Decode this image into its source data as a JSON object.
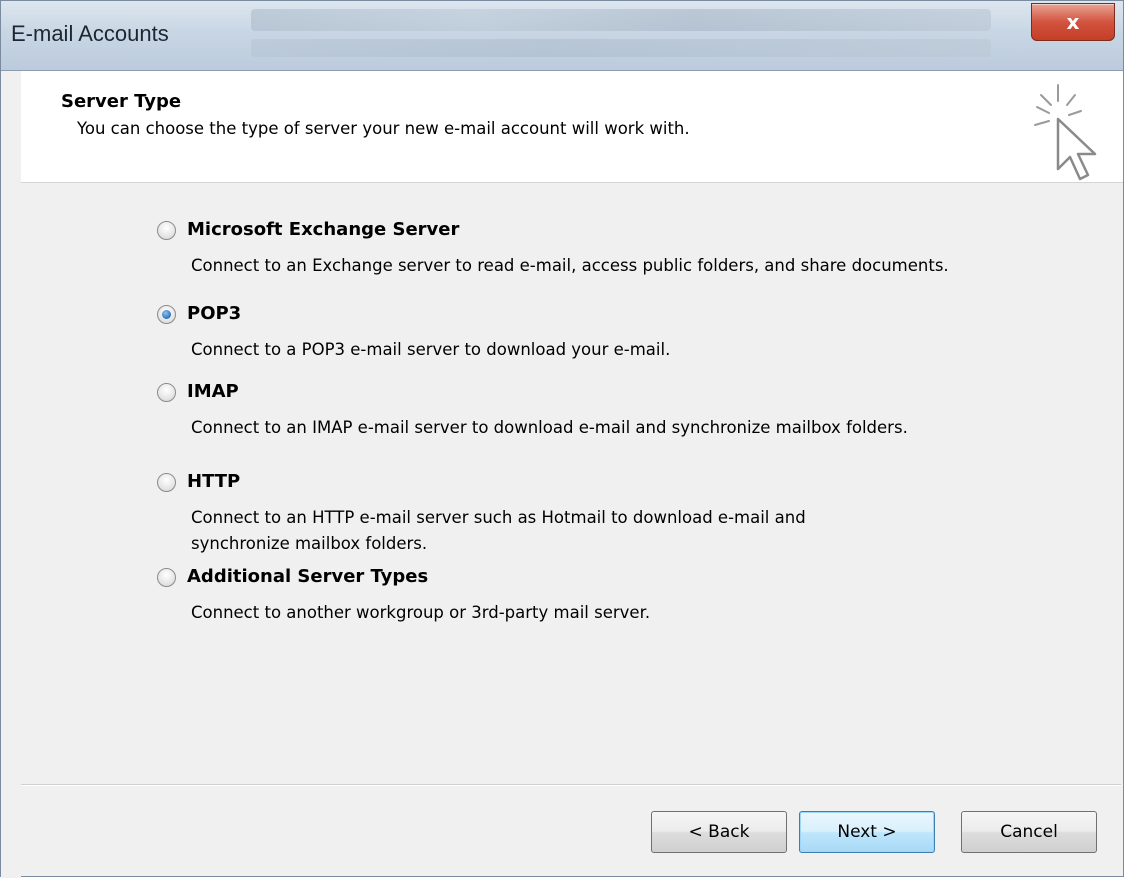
{
  "window": {
    "title": "E-mail Accounts",
    "close_glyph": "x"
  },
  "header": {
    "title": "Server Type",
    "description": "You can choose the type of server your new e-mail account will work with.",
    "graphic_icon": "cursor-sparkle-icon"
  },
  "options": [
    {
      "label": "Microsoft Exchange Server",
      "description": "Connect to an Exchange server to read e-mail, access public folders, and share documents.",
      "selected": false
    },
    {
      "label": "POP3",
      "description": "Connect to a POP3 e-mail server to download your e-mail.",
      "selected": true
    },
    {
      "label": "IMAP",
      "description": "Connect to an IMAP e-mail server to download e-mail and synchronize mailbox folders.",
      "selected": false
    },
    {
      "label": "HTTP",
      "description": "Connect to an HTTP e-mail server such as Hotmail to download e-mail and synchronize mailbox folders.",
      "selected": false
    },
    {
      "label": "Additional Server Types",
      "description": "Connect to another workgroup or 3rd-party mail server.",
      "selected": false
    }
  ],
  "buttons": {
    "back": "< Back",
    "next": "Next >",
    "cancel": "Cancel"
  },
  "colors": {
    "selected_radio": "#2b6fb8",
    "close_button": "#c43e27",
    "default_button_border": "#3c7fb1"
  }
}
